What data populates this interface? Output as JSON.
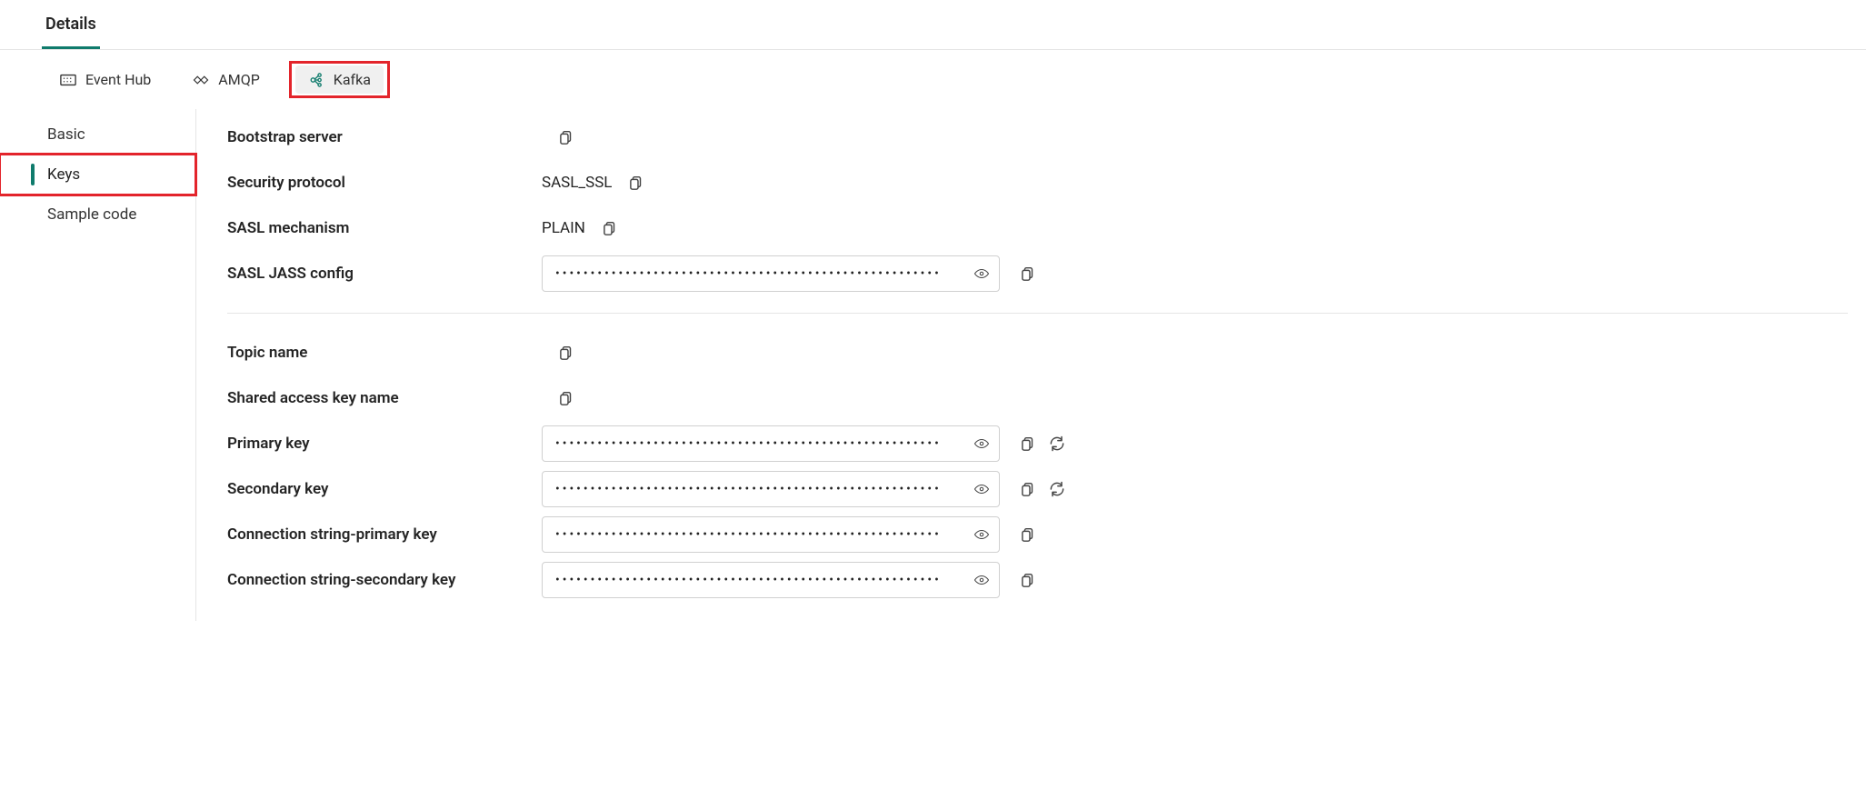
{
  "top_tab_label": "Details",
  "protocol_tabs": {
    "eventhub": "Event Hub",
    "amqp": "AMQP",
    "kafka": "Kafka"
  },
  "sidebar": {
    "basic": "Basic",
    "keys": "Keys",
    "sample": "Sample code"
  },
  "fields": {
    "bootstrap_server": {
      "label": "Bootstrap server",
      "value": ""
    },
    "security_protocol": {
      "label": "Security protocol",
      "value": "SASL_SSL"
    },
    "sasl_mechanism": {
      "label": "SASL mechanism",
      "value": "PLAIN"
    },
    "sasl_jass_config": {
      "label": "SASL JASS config",
      "masked": "•••••••••••••••••••••••••••••••••••••••••••••••••••••••"
    },
    "topic_name": {
      "label": "Topic name",
      "value": ""
    },
    "shared_access_key_name": {
      "label": "Shared access key name",
      "value": ""
    },
    "primary_key": {
      "label": "Primary key",
      "masked": "•••••••••••••••••••••••••••••••••••••••••••••••••••••••"
    },
    "secondary_key": {
      "label": "Secondary key",
      "masked": "•••••••••••••••••••••••••••••••••••••••••••••••••••••••"
    },
    "conn_primary": {
      "label": "Connection string-primary key",
      "masked": "•••••••••••••••••••••••••••••••••••••••••••••••••••••••"
    },
    "conn_secondary": {
      "label": "Connection string-secondary key",
      "masked": "•••••••••••••••••••••••••••••••••••••••••••••••••••••••"
    }
  },
  "highlight": {
    "kafka_tab": true,
    "keys_side": true
  }
}
